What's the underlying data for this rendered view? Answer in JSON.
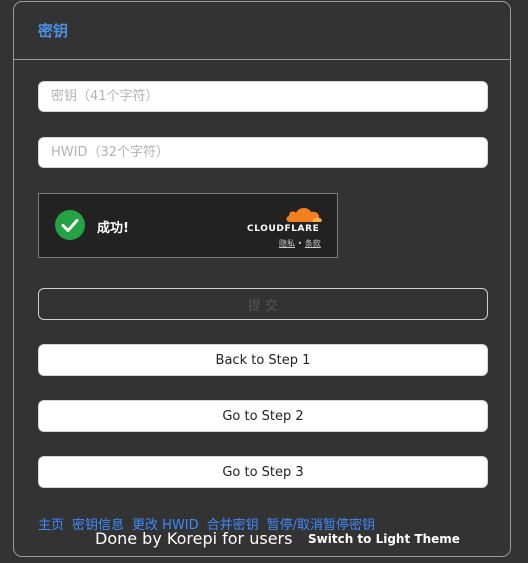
{
  "header": {
    "title": "密钥"
  },
  "form": {
    "key_placeholder": "密钥（41个字符）",
    "hwid_placeholder": "HWID（32个字符）",
    "submit_label": "提 交"
  },
  "captcha": {
    "status": "成功!",
    "brand": "CLOUDFLARE",
    "privacy_link": "隐私",
    "separator": "•",
    "terms_link": "条款"
  },
  "steps": {
    "back1": "Back to Step 1",
    "go2": "Go to Step 2",
    "go3": "Go to Step 3"
  },
  "footer": {
    "links": [
      "主页",
      "密钥信息",
      "更改 HWID",
      "合并密钥",
      "暂停/取消暂停密钥"
    ],
    "done_text": "Done by Korepi for users",
    "theme_toggle": "Switch to Light Theme"
  },
  "colors": {
    "background": "#333333",
    "accent": "#4a90e2",
    "link": "#3d8bfd",
    "success": "#25a244",
    "cloudflare_orange": "#f38020"
  }
}
